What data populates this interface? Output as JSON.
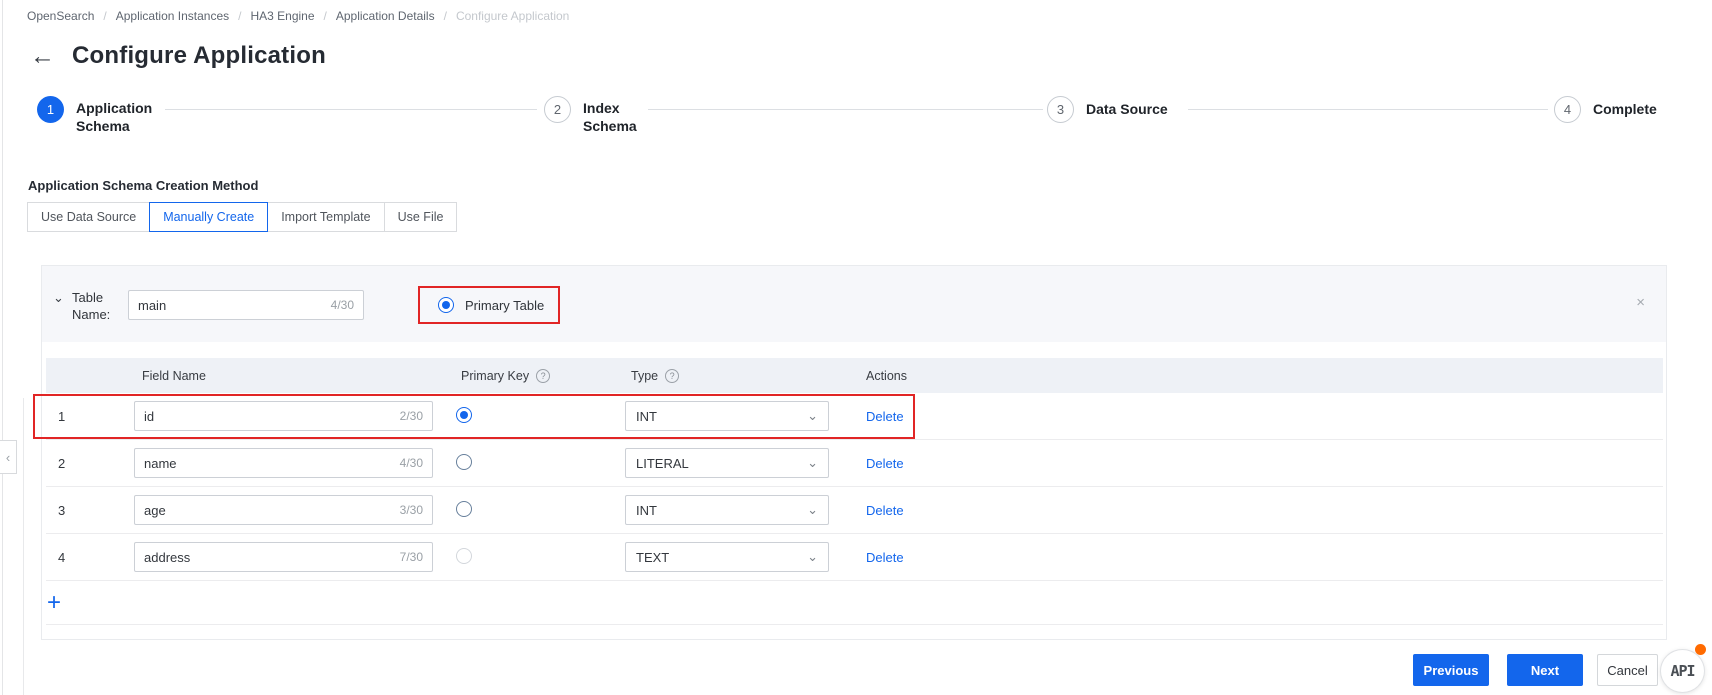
{
  "breadcrumb": {
    "separator": "/",
    "items": [
      "OpenSearch",
      "Application Instances",
      "HA3 Engine",
      "Application Details",
      "Configure Application"
    ]
  },
  "header": {
    "title": "Configure Application"
  },
  "stepper": {
    "steps": [
      {
        "num": "1",
        "label": "Application Schema",
        "active": true
      },
      {
        "num": "2",
        "label": "Index Schema",
        "active": false
      },
      {
        "num": "3",
        "label": "Data Source",
        "active": false
      },
      {
        "num": "4",
        "label": "Complete",
        "active": false
      }
    ]
  },
  "creation_method": {
    "label": "Application Schema Creation Method",
    "options": [
      {
        "label": "Use Data Source",
        "selected": false
      },
      {
        "label": "Manually Create",
        "selected": true
      },
      {
        "label": "Import Template",
        "selected": false
      },
      {
        "label": "Use File",
        "selected": false
      }
    ]
  },
  "table_panel": {
    "table_name_label": "Table Name:",
    "table_name_value": "main",
    "table_name_counter": "4/30",
    "primary_table_label": "Primary Table",
    "primary_table_checked": true,
    "columns": {
      "field_name": "Field Name",
      "primary_key": "Primary Key",
      "type": "Type",
      "actions": "Actions"
    },
    "rows": [
      {
        "index": "1",
        "field": "id",
        "counter": "2/30",
        "primary": true,
        "type": "INT",
        "action": "Delete",
        "highlighted": true,
        "radio_disabled": false
      },
      {
        "index": "2",
        "field": "name",
        "counter": "4/30",
        "primary": false,
        "type": "LITERAL",
        "action": "Delete",
        "highlighted": false,
        "radio_disabled": false
      },
      {
        "index": "3",
        "field": "age",
        "counter": "3/30",
        "primary": false,
        "type": "INT",
        "action": "Delete",
        "highlighted": false,
        "radio_disabled": false
      },
      {
        "index": "4",
        "field": "address",
        "counter": "7/30",
        "primary": false,
        "type": "TEXT",
        "action": "Delete",
        "highlighted": false,
        "radio_disabled": true
      }
    ]
  },
  "footer": {
    "previous": "Previous",
    "next": "Next",
    "cancel": "Cancel",
    "api_label": "API"
  },
  "icons": {
    "back": "←",
    "chevron_down": "⌄",
    "dropdown_chevron": "⌄",
    "collapse_left": "‹",
    "close": "×",
    "help": "?",
    "add": "+"
  },
  "colors": {
    "accent_blue": "#1366ec",
    "annotation_red": "#e12525",
    "api_dot_orange": "#ff6a00",
    "panel_header_bg": "#f6f7fa",
    "table_header_bg": "#eef1f6"
  }
}
